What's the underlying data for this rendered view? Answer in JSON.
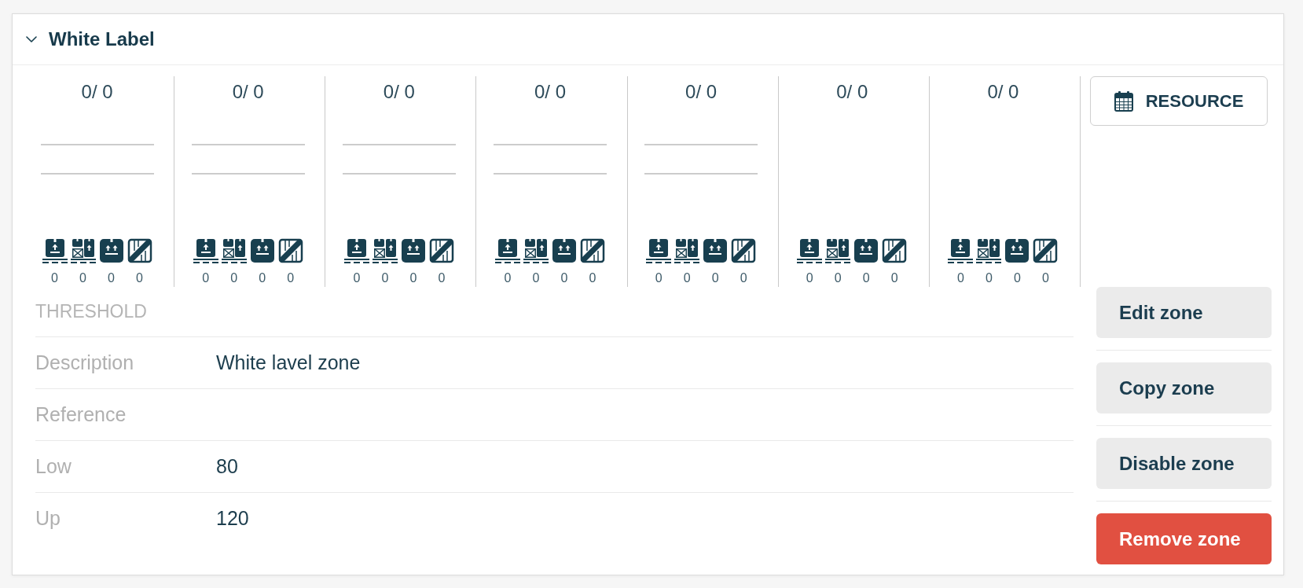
{
  "panel": {
    "title": "White Label",
    "expanded": true
  },
  "columns": [
    {
      "ratio": "0/ 0",
      "bars": true,
      "counts": [
        {
          "kind": "pallet",
          "count": "0"
        },
        {
          "kind": "stack",
          "count": "0"
        },
        {
          "kind": "box",
          "count": "0"
        },
        {
          "kind": "crate",
          "count": "0"
        }
      ]
    },
    {
      "ratio": "0/ 0",
      "bars": true,
      "counts": [
        {
          "kind": "pallet",
          "count": "0"
        },
        {
          "kind": "stack",
          "count": "0"
        },
        {
          "kind": "box",
          "count": "0"
        },
        {
          "kind": "crate",
          "count": "0"
        }
      ]
    },
    {
      "ratio": "0/ 0",
      "bars": true,
      "counts": [
        {
          "kind": "pallet",
          "count": "0"
        },
        {
          "kind": "stack",
          "count": "0"
        },
        {
          "kind": "box",
          "count": "0"
        },
        {
          "kind": "crate",
          "count": "0"
        }
      ]
    },
    {
      "ratio": "0/ 0",
      "bars": true,
      "counts": [
        {
          "kind": "pallet",
          "count": "0"
        },
        {
          "kind": "stack",
          "count": "0"
        },
        {
          "kind": "box",
          "count": "0"
        },
        {
          "kind": "crate",
          "count": "0"
        }
      ]
    },
    {
      "ratio": "0/ 0",
      "bars": true,
      "counts": [
        {
          "kind": "pallet",
          "count": "0"
        },
        {
          "kind": "stack",
          "count": "0"
        },
        {
          "kind": "box",
          "count": "0"
        },
        {
          "kind": "crate",
          "count": "0"
        }
      ]
    },
    {
      "ratio": "0/ 0",
      "bars": false,
      "counts": [
        {
          "kind": "pallet",
          "count": "0"
        },
        {
          "kind": "stack",
          "count": "0"
        },
        {
          "kind": "box",
          "count": "0"
        },
        {
          "kind": "crate",
          "count": "0"
        }
      ]
    },
    {
      "ratio": "0/ 0",
      "bars": false,
      "counts": [
        {
          "kind": "pallet",
          "count": "0"
        },
        {
          "kind": "stack",
          "count": "0"
        },
        {
          "kind": "box",
          "count": "0"
        },
        {
          "kind": "crate",
          "count": "0"
        }
      ]
    }
  ],
  "resource_button": {
    "label": "RESOURCE"
  },
  "threshold": {
    "heading": "THRESHOLD",
    "rows": [
      {
        "label": "Description",
        "value": "White lavel zone"
      },
      {
        "label": "Reference"
      },
      {
        "label": "Low",
        "value": "80"
      },
      {
        "label": "Up",
        "value": "120"
      }
    ]
  },
  "actions": [
    {
      "label": "Edit zone",
      "kind": "default"
    },
    {
      "label": "Copy zone",
      "kind": "default"
    },
    {
      "label": "Disable zone",
      "kind": "default"
    },
    {
      "label": "Remove zone",
      "kind": "danger"
    }
  ]
}
